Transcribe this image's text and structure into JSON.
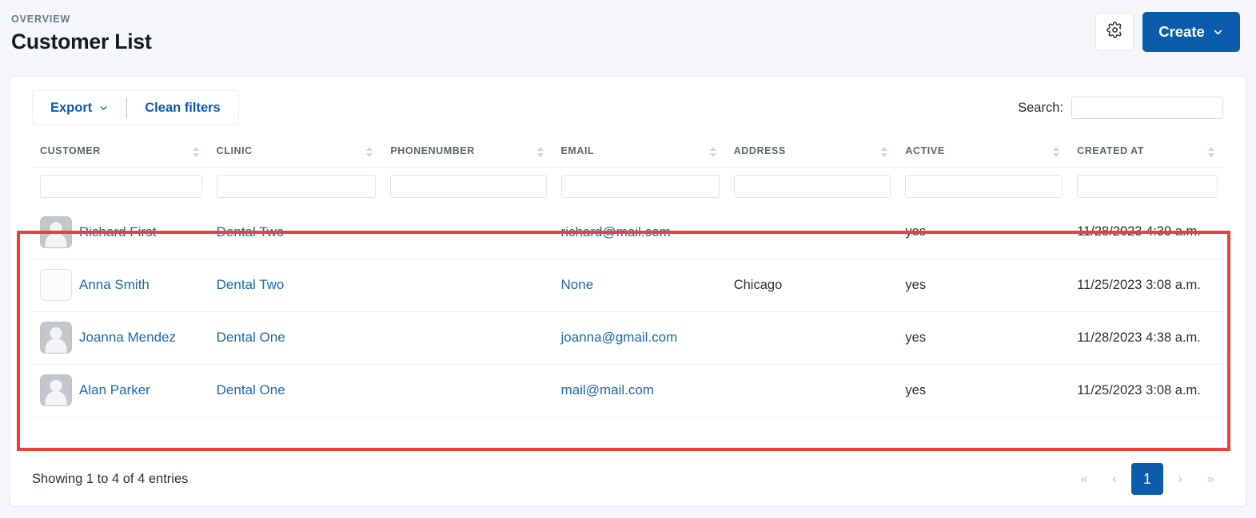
{
  "header": {
    "eyebrow": "OVERVIEW",
    "title": "Customer List",
    "gear_icon": "gear-icon",
    "create_label": "Create",
    "create_chevron": "chevron-down-icon"
  },
  "toolbar": {
    "export_label": "Export",
    "export_chevron": "chevron-down-icon",
    "clean_filters_label": "Clean filters",
    "search_label": "Search:",
    "search_value": "",
    "search_placeholder": ""
  },
  "table": {
    "columns": [
      {
        "label": "CUSTOMER",
        "filter_value": ""
      },
      {
        "label": "CLINIC",
        "filter_value": ""
      },
      {
        "label": "PHONENUMBER",
        "filter_value": ""
      },
      {
        "label": "EMAIL",
        "filter_value": ""
      },
      {
        "label": "ADDRESS",
        "filter_value": ""
      },
      {
        "label": "ACTIVE",
        "filter_value": ""
      },
      {
        "label": "CREATED AT",
        "filter_value": ""
      }
    ],
    "rows": [
      {
        "customer": "Richard First",
        "avatar": "person-avatar",
        "clinic": "Dental Two",
        "phonenumber": "",
        "email": "richard@mail.com",
        "address": "",
        "active": "yes",
        "created_at": "11/28/2023 4:39 a.m."
      },
      {
        "customer": "Anna Smith",
        "avatar": "blank-avatar",
        "clinic": "Dental Two",
        "phonenumber": "",
        "email": "None",
        "address": "Chicago",
        "active": "yes",
        "created_at": "11/25/2023 3:08 a.m."
      },
      {
        "customer": "Joanna Mendez",
        "avatar": "person-avatar",
        "clinic": "Dental One",
        "phonenumber": "",
        "email": "joanna@gmail.com",
        "address": "",
        "active": "yes",
        "created_at": "11/28/2023 4:38 a.m."
      },
      {
        "customer": "Alan Parker",
        "avatar": "person-avatar",
        "clinic": "Dental One",
        "phonenumber": "",
        "email": "mail@mail.com",
        "address": "",
        "active": "yes",
        "created_at": "11/25/2023 3:08 a.m."
      }
    ]
  },
  "footer": {
    "entries_info": "Showing 1 to 4 of 4 entries",
    "pagination": {
      "first": "«",
      "prev": "‹",
      "pages": [
        "1"
      ],
      "next": "›",
      "last": "»"
    }
  },
  "colors": {
    "accent": "#0b5cab",
    "link": "#1b6aa8",
    "highlight": "#ef3e36",
    "page_bg": "#f4f6f9"
  }
}
